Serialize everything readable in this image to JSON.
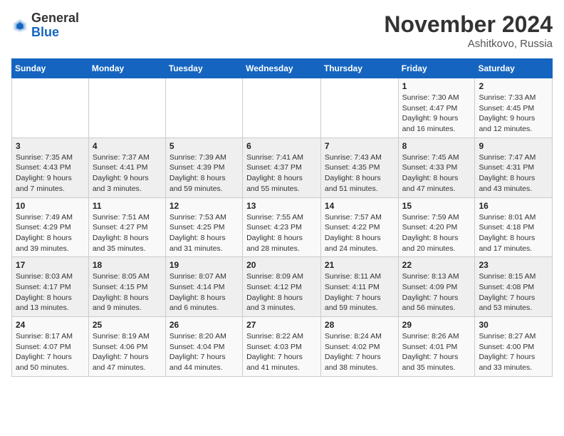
{
  "header": {
    "logo_general": "General",
    "logo_blue": "Blue",
    "month_title": "November 2024",
    "location": "Ashitkovo, Russia"
  },
  "days_of_week": [
    "Sunday",
    "Monday",
    "Tuesday",
    "Wednesday",
    "Thursday",
    "Friday",
    "Saturday"
  ],
  "weeks": [
    [
      {
        "day": "",
        "info": ""
      },
      {
        "day": "",
        "info": ""
      },
      {
        "day": "",
        "info": ""
      },
      {
        "day": "",
        "info": ""
      },
      {
        "day": "",
        "info": ""
      },
      {
        "day": "1",
        "info": "Sunrise: 7:30 AM\nSunset: 4:47 PM\nDaylight: 9 hours and 16 minutes."
      },
      {
        "day": "2",
        "info": "Sunrise: 7:33 AM\nSunset: 4:45 PM\nDaylight: 9 hours and 12 minutes."
      }
    ],
    [
      {
        "day": "3",
        "info": "Sunrise: 7:35 AM\nSunset: 4:43 PM\nDaylight: 9 hours and 7 minutes."
      },
      {
        "day": "4",
        "info": "Sunrise: 7:37 AM\nSunset: 4:41 PM\nDaylight: 9 hours and 3 minutes."
      },
      {
        "day": "5",
        "info": "Sunrise: 7:39 AM\nSunset: 4:39 PM\nDaylight: 8 hours and 59 minutes."
      },
      {
        "day": "6",
        "info": "Sunrise: 7:41 AM\nSunset: 4:37 PM\nDaylight: 8 hours and 55 minutes."
      },
      {
        "day": "7",
        "info": "Sunrise: 7:43 AM\nSunset: 4:35 PM\nDaylight: 8 hours and 51 minutes."
      },
      {
        "day": "8",
        "info": "Sunrise: 7:45 AM\nSunset: 4:33 PM\nDaylight: 8 hours and 47 minutes."
      },
      {
        "day": "9",
        "info": "Sunrise: 7:47 AM\nSunset: 4:31 PM\nDaylight: 8 hours and 43 minutes."
      }
    ],
    [
      {
        "day": "10",
        "info": "Sunrise: 7:49 AM\nSunset: 4:29 PM\nDaylight: 8 hours and 39 minutes."
      },
      {
        "day": "11",
        "info": "Sunrise: 7:51 AM\nSunset: 4:27 PM\nDaylight: 8 hours and 35 minutes."
      },
      {
        "day": "12",
        "info": "Sunrise: 7:53 AM\nSunset: 4:25 PM\nDaylight: 8 hours and 31 minutes."
      },
      {
        "day": "13",
        "info": "Sunrise: 7:55 AM\nSunset: 4:23 PM\nDaylight: 8 hours and 28 minutes."
      },
      {
        "day": "14",
        "info": "Sunrise: 7:57 AM\nSunset: 4:22 PM\nDaylight: 8 hours and 24 minutes."
      },
      {
        "day": "15",
        "info": "Sunrise: 7:59 AM\nSunset: 4:20 PM\nDaylight: 8 hours and 20 minutes."
      },
      {
        "day": "16",
        "info": "Sunrise: 8:01 AM\nSunset: 4:18 PM\nDaylight: 8 hours and 17 minutes."
      }
    ],
    [
      {
        "day": "17",
        "info": "Sunrise: 8:03 AM\nSunset: 4:17 PM\nDaylight: 8 hours and 13 minutes."
      },
      {
        "day": "18",
        "info": "Sunrise: 8:05 AM\nSunset: 4:15 PM\nDaylight: 8 hours and 9 minutes."
      },
      {
        "day": "19",
        "info": "Sunrise: 8:07 AM\nSunset: 4:14 PM\nDaylight: 8 hours and 6 minutes."
      },
      {
        "day": "20",
        "info": "Sunrise: 8:09 AM\nSunset: 4:12 PM\nDaylight: 8 hours and 3 minutes."
      },
      {
        "day": "21",
        "info": "Sunrise: 8:11 AM\nSunset: 4:11 PM\nDaylight: 7 hours and 59 minutes."
      },
      {
        "day": "22",
        "info": "Sunrise: 8:13 AM\nSunset: 4:09 PM\nDaylight: 7 hours and 56 minutes."
      },
      {
        "day": "23",
        "info": "Sunrise: 8:15 AM\nSunset: 4:08 PM\nDaylight: 7 hours and 53 minutes."
      }
    ],
    [
      {
        "day": "24",
        "info": "Sunrise: 8:17 AM\nSunset: 4:07 PM\nDaylight: 7 hours and 50 minutes."
      },
      {
        "day": "25",
        "info": "Sunrise: 8:19 AM\nSunset: 4:06 PM\nDaylight: 7 hours and 47 minutes."
      },
      {
        "day": "26",
        "info": "Sunrise: 8:20 AM\nSunset: 4:04 PM\nDaylight: 7 hours and 44 minutes."
      },
      {
        "day": "27",
        "info": "Sunrise: 8:22 AM\nSunset: 4:03 PM\nDaylight: 7 hours and 41 minutes."
      },
      {
        "day": "28",
        "info": "Sunrise: 8:24 AM\nSunset: 4:02 PM\nDaylight: 7 hours and 38 minutes."
      },
      {
        "day": "29",
        "info": "Sunrise: 8:26 AM\nSunset: 4:01 PM\nDaylight: 7 hours and 35 minutes."
      },
      {
        "day": "30",
        "info": "Sunrise: 8:27 AM\nSunset: 4:00 PM\nDaylight: 7 hours and 33 minutes."
      }
    ]
  ]
}
